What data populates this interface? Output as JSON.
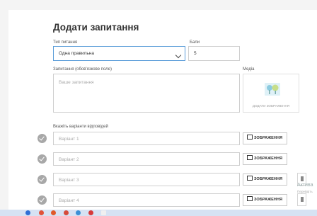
{
  "form": {
    "title": "Додати запитання",
    "type_label": "Тип питання",
    "type_value": "Одна правильна",
    "points_label": "Бали",
    "points_value": "5",
    "question_label": "Запитання (обов'язкове поле)",
    "question_placeholder": "Ваше запитання",
    "media_label": "Медіа",
    "add_image_label": "ДОДАТИ ЗОБРАЖЕННЯ",
    "answers_label": "Вкажіть варіанти відповідей",
    "answers": [
      {
        "placeholder": "Варіант 1",
        "image_label": "ЗОБРАЖЕННЯ"
      },
      {
        "placeholder": "Варіант 2",
        "image_label": "ЗОБРАЖЕННЯ"
      },
      {
        "placeholder": "Варіант 3",
        "image_label": "ЗОБРАЖЕННЯ"
      },
      {
        "placeholder": "Варіант 4",
        "image_label": "ЗОБРАЖЕННЯ"
      }
    ]
  },
  "overlay": {
    "activate_text": "Актива",
    "activate_subtext": "Перейдіть"
  },
  "colors": {
    "select_border": "#5b9dd9",
    "check_grey": "#a8a8a8",
    "taskbar": "#d6e2f3"
  }
}
